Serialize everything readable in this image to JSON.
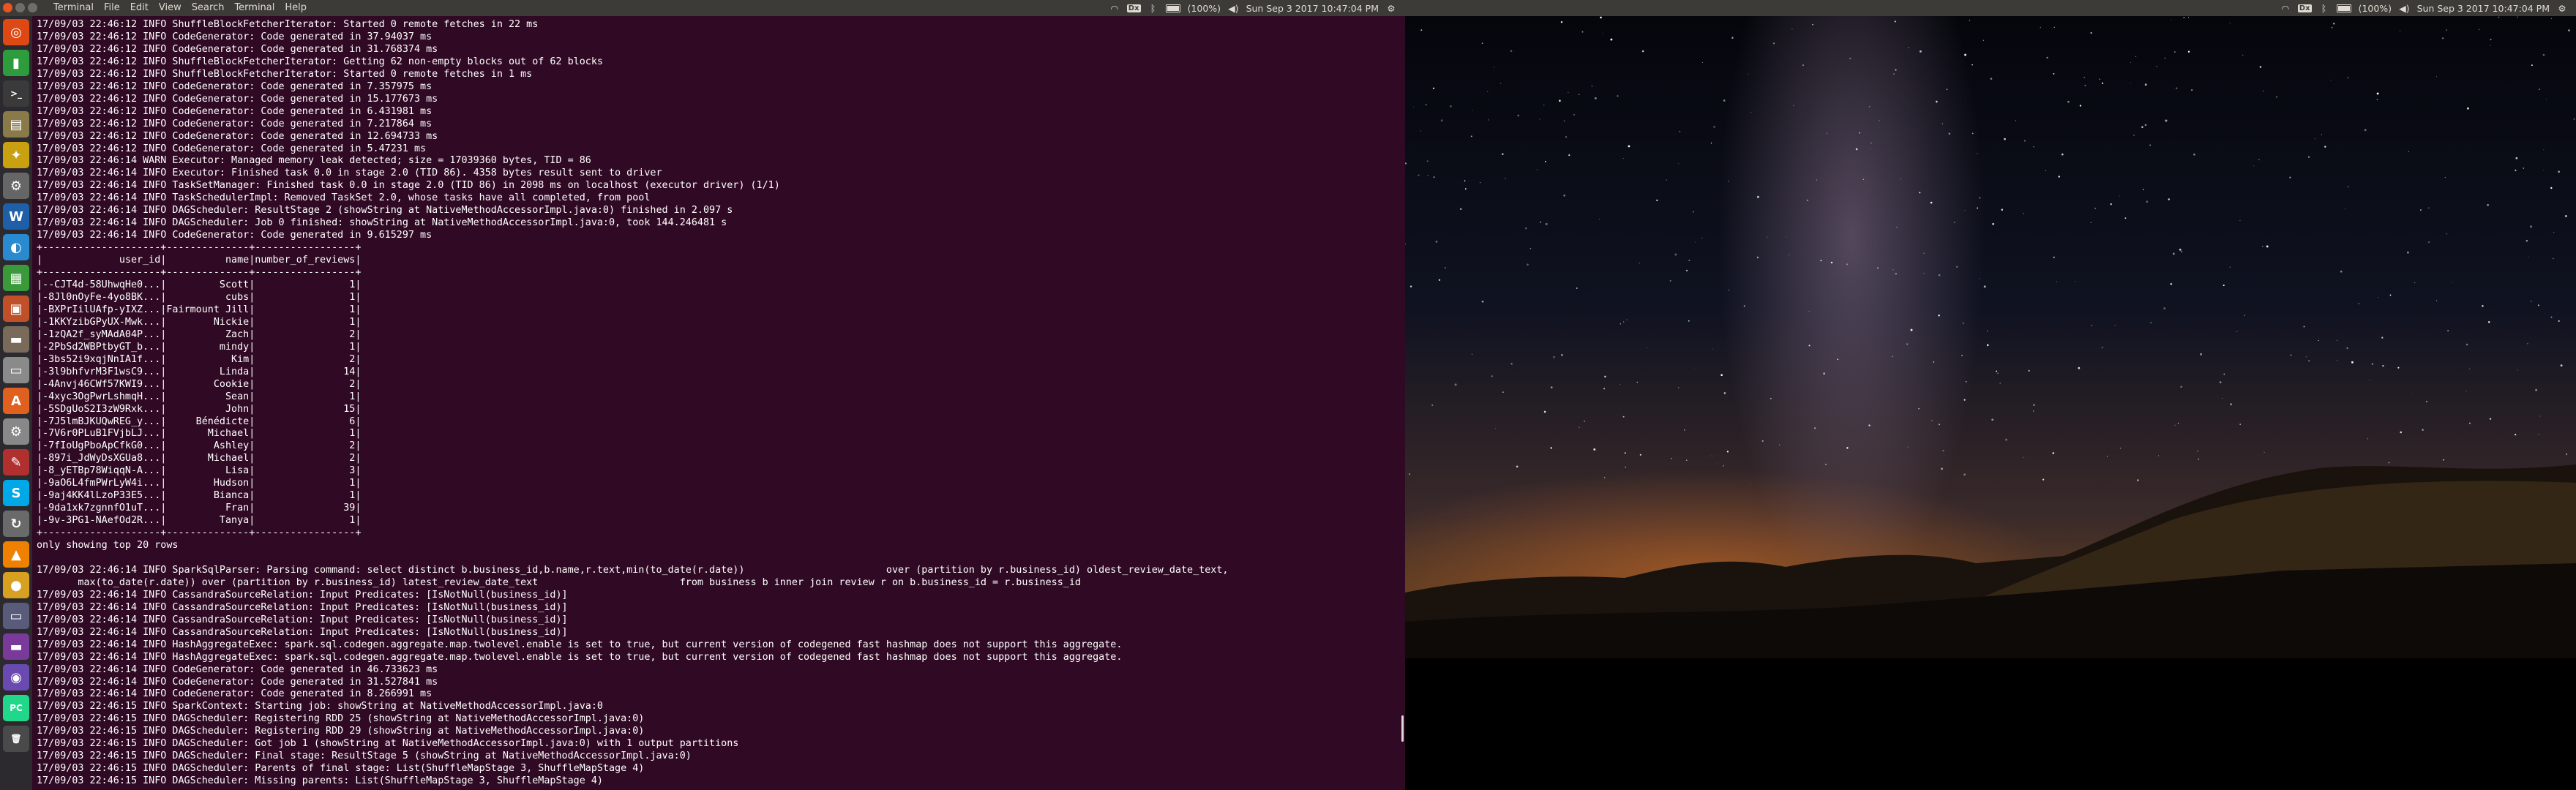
{
  "colors": {
    "panel": "#3c3b37",
    "terminal_bg": "#300a24",
    "launcher": "#2d2a2f",
    "close": "#e9541f"
  },
  "panel": {
    "menu": [
      "Terminal",
      "File",
      "Edit",
      "View",
      "Search",
      "Terminal",
      "Help"
    ],
    "left_tray": {
      "battery": "(100%)",
      "clock": "Sun Sep 3 2017 10:47:04 PM",
      "dx": "Dx"
    },
    "right_tray": {
      "battery": "(100%)",
      "clock": "Sun Sep 3 2017 10:47:04 PM",
      "dx": "Dx"
    },
    "icons": [
      "wifi-icon",
      "bluetooth-icon",
      "battery-icon",
      "volume-icon",
      "gear-icon"
    ]
  },
  "launcher": {
    "items": [
      {
        "name": "ubuntu-dash-icon",
        "glyph": "◎",
        "color": "#dd4814"
      },
      {
        "name": "terminal-app-icon",
        "glyph": "▮",
        "color": "#2d9c3c"
      },
      {
        "name": "terminal-icon",
        "glyph": ">_",
        "color": "#3a3a3a"
      },
      {
        "name": "files-icon",
        "glyph": "▤",
        "color": "#8a7a4a"
      },
      {
        "name": "transmission-icon",
        "glyph": "✦",
        "color": "#c8a010"
      },
      {
        "name": "settings-icon",
        "glyph": "⚙",
        "color": "#666666"
      },
      {
        "name": "writer-icon",
        "glyph": "W",
        "color": "#1e5fa8"
      },
      {
        "name": "sync-icon",
        "glyph": "◐",
        "color": "#2a8ad0"
      },
      {
        "name": "calc-icon",
        "glyph": "▦",
        "color": "#3a9a3a"
      },
      {
        "name": "impress-icon",
        "glyph": "▣",
        "color": "#c0502a"
      },
      {
        "name": "archive-icon",
        "glyph": "▬",
        "color": "#7a6a5a"
      },
      {
        "name": "text-editor-icon",
        "glyph": "▭",
        "color": "#8a8a8a"
      },
      {
        "name": "software-center-icon",
        "glyph": "A",
        "color": "#e06020"
      },
      {
        "name": "system-settings-icon",
        "glyph": "⚙",
        "color": "#888888"
      },
      {
        "name": "tweak-icon",
        "glyph": "✎",
        "color": "#b03030"
      },
      {
        "name": "skype-icon",
        "glyph": "S",
        "color": "#00a8e8"
      },
      {
        "name": "update-icon",
        "glyph": "↻",
        "color": "#6a6a6a"
      },
      {
        "name": "vlc-icon",
        "glyph": "▲",
        "color": "#f08000"
      },
      {
        "name": "chrome-icon",
        "glyph": "●",
        "color": "#d8a020"
      },
      {
        "name": "monitor-icon",
        "glyph": "▭",
        "color": "#5a5a7a"
      },
      {
        "name": "app-purple-icon",
        "glyph": "▬",
        "color": "#7a3a9a"
      },
      {
        "name": "firefox-icon",
        "glyph": "◉",
        "color": "#6a4ab0"
      },
      {
        "name": "pycharm-icon",
        "glyph": "PC",
        "color": "#21d789"
      },
      {
        "name": "trash-icon",
        "glyph": "🗑",
        "color": "#4a4a4a"
      }
    ]
  },
  "terminal": {
    "lines": [
      "17/09/03 22:46:12 INFO ShuffleBlockFetcherIterator: Started 0 remote fetches in 22 ms",
      "17/09/03 22:46:12 INFO CodeGenerator: Code generated in 37.94037 ms",
      "17/09/03 22:46:12 INFO CodeGenerator: Code generated in 31.768374 ms",
      "17/09/03 22:46:12 INFO ShuffleBlockFetcherIterator: Getting 62 non-empty blocks out of 62 blocks",
      "17/09/03 22:46:12 INFO ShuffleBlockFetcherIterator: Started 0 remote fetches in 1 ms",
      "17/09/03 22:46:12 INFO CodeGenerator: Code generated in 7.357975 ms",
      "17/09/03 22:46:12 INFO CodeGenerator: Code generated in 15.177673 ms",
      "17/09/03 22:46:12 INFO CodeGenerator: Code generated in 6.431981 ms",
      "17/09/03 22:46:12 INFO CodeGenerator: Code generated in 7.217864 ms",
      "17/09/03 22:46:12 INFO CodeGenerator: Code generated in 12.694733 ms",
      "17/09/03 22:46:12 INFO CodeGenerator: Code generated in 5.47231 ms",
      "17/09/03 22:46:14 WARN Executor: Managed memory leak detected; size = 17039360 bytes, TID = 86",
      "17/09/03 22:46:14 INFO Executor: Finished task 0.0 in stage 2.0 (TID 86). 4358 bytes result sent to driver",
      "17/09/03 22:46:14 INFO TaskSetManager: Finished task 0.0 in stage 2.0 (TID 86) in 2098 ms on localhost (executor driver) (1/1)",
      "17/09/03 22:46:14 INFO TaskSchedulerImpl: Removed TaskSet 2.0, whose tasks have all completed, from pool",
      "17/09/03 22:46:14 INFO DAGScheduler: ResultStage 2 (showString at NativeMethodAccessorImpl.java:0) finished in 2.097 s",
      "17/09/03 22:46:14 INFO DAGScheduler: Job 0 finished: showString at NativeMethodAccessorImpl.java:0, took 144.246481 s",
      "17/09/03 22:46:14 INFO CodeGenerator: Code generated in 9.615297 ms",
      "+--------------------+--------------+-----------------+",
      "|             user_id|          name|number_of_reviews|",
      "+--------------------+--------------+-----------------+",
      "|--CJT4d-58UhwqHe0...|         Scott|                1|",
      "|-8Jl0nOyFe-4yo8BK...|          cubs|                1|",
      "|-BXPrIilUAfp-yIXZ...|Fairmount Jill|                1|",
      "|-1KKYzibGPyUX-Mwk...|        Nickie|                1|",
      "|-1zQA2f_syMAdA04P...|          Zach|                2|",
      "|-2PbSd2WBPtbyGT_b...|         mindy|                1|",
      "|-3bs52i9xqjNnIA1f...|           Kim|                2|",
      "|-3l9bhfvrM3F1wsC9...|         Linda|               14|",
      "|-4Anvj46CWf57KWI9...|        Cookie|                2|",
      "|-4xyc3OgPwrLshmqH...|          Sean|                1|",
      "|-5SDgUoS2I3zW9Rxk...|          John|               15|",
      "|-7J5lmBJKUQwREG_y...|     Bénédicte|                6|",
      "|-7V6r0PLuB1FVjbLJ...|       Michael|                1|",
      "|-7fIoUgPboApCfkG0...|        Ashley|                2|",
      "|-897i_JdWyDsXGUa8...|       Michael|                2|",
      "|-8_yETBp78WiqqN-A...|          Lisa|                3|",
      "|-9aO6L4fmPWrLyW4i...|        Hudson|                1|",
      "|-9aj4KK4lLzoP33E5...|        Bianca|                1|",
      "|-9da1xk7zgnnfO1uT...|          Fran|               39|",
      "|-9v-3PG1-NAefOd2R...|         Tanya|                1|",
      "+--------------------+--------------+-----------------+",
      "only showing top 20 rows",
      "",
      "17/09/03 22:46:14 INFO SparkSqlParser: Parsing command: select distinct b.business_id,b.name,r.text,min(to_date(r.date))                        over (partition by r.business_id) oldest_review_date_text,",
      "       max(to_date(r.date)) over (partition by r.business_id) latest_review_date_text                        from business b inner join review r on b.business_id = r.business_id",
      "17/09/03 22:46:14 INFO CassandraSourceRelation: Input Predicates: [IsNotNull(business_id)]",
      "17/09/03 22:46:14 INFO CassandraSourceRelation: Input Predicates: [IsNotNull(business_id)]",
      "17/09/03 22:46:14 INFO CassandraSourceRelation: Input Predicates: [IsNotNull(business_id)]",
      "17/09/03 22:46:14 INFO CassandraSourceRelation: Input Predicates: [IsNotNull(business_id)]",
      "17/09/03 22:46:14 INFO HashAggregateExec: spark.sql.codegen.aggregate.map.twolevel.enable is set to true, but current version of codegened fast hashmap does not support this aggregate.",
      "17/09/03 22:46:14 INFO HashAggregateExec: spark.sql.codegen.aggregate.map.twolevel.enable is set to true, but current version of codegened fast hashmap does not support this aggregate.",
      "17/09/03 22:46:14 INFO CodeGenerator: Code generated in 46.733623 ms",
      "17/09/03 22:46:14 INFO CodeGenerator: Code generated in 31.527841 ms",
      "17/09/03 22:46:14 INFO CodeGenerator: Code generated in 8.266991 ms",
      "17/09/03 22:46:15 INFO SparkContext: Starting job: showString at NativeMethodAccessorImpl.java:0",
      "17/09/03 22:46:15 INFO DAGScheduler: Registering RDD 25 (showString at NativeMethodAccessorImpl.java:0)",
      "17/09/03 22:46:15 INFO DAGScheduler: Registering RDD 29 (showString at NativeMethodAccessorImpl.java:0)",
      "17/09/03 22:46:15 INFO DAGScheduler: Got job 1 (showString at NativeMethodAccessorImpl.java:0) with 1 output partitions",
      "17/09/03 22:46:15 INFO DAGScheduler: Final stage: ResultStage 5 (showString at NativeMethodAccessorImpl.java:0)",
      "17/09/03 22:46:15 INFO DAGScheduler: Parents of final stage: List(ShuffleMapStage 3, ShuffleMapStage 4)",
      "17/09/03 22:46:15 INFO DAGScheduler: Missing parents: List(ShuffleMapStage 3, ShuffleMapStage 4)"
    ]
  }
}
